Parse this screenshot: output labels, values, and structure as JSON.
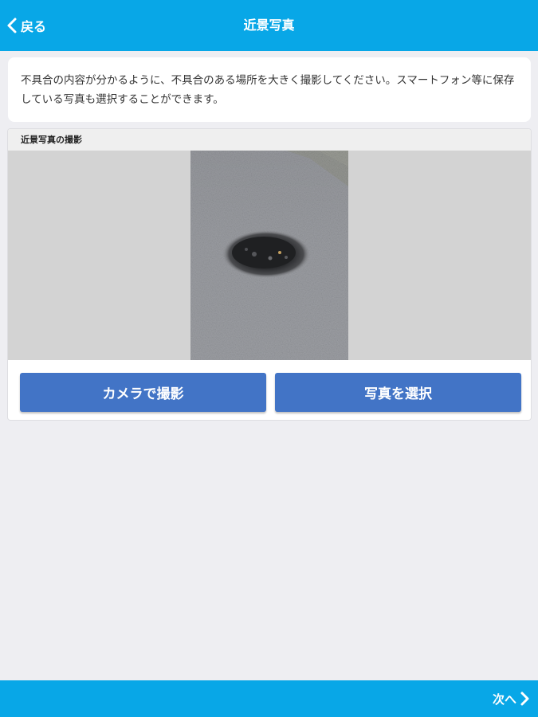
{
  "header": {
    "back_label": "戻る",
    "back_icon": "chevron-left-icon",
    "title": "近景写真"
  },
  "instructions": {
    "text": "不具合の内容が分かるように、不具合のある場所を大きく撮影してください。スマートフォン等に保存している写真も選択することができます。"
  },
  "photo_section": {
    "label": "近景写真の撮影",
    "photo": "pothole-closeup-photo"
  },
  "actions": {
    "camera_label": "カメラで撮影",
    "select_label": "写真を選択"
  },
  "footer": {
    "next_label": "次へ",
    "next_icon": "chevron-right-icon"
  },
  "colors": {
    "accent": "#08a7e7",
    "button": "#4274c6",
    "background": "#eeeef2",
    "photo_background": "#d3d3d3"
  }
}
